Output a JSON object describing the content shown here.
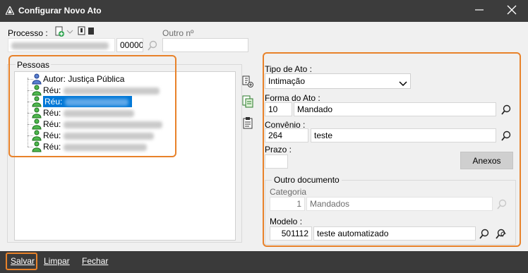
{
  "window": {
    "title": "Configurar Novo Ato",
    "app_icon": "triangle-logo-icon",
    "min_icon": "minimize-icon",
    "close_icon": "close-icon"
  },
  "processo": {
    "label": "Processo :",
    "number_value": "",
    "suffix_value": "00000",
    "outro_label": "Outro nº",
    "outro_value": ""
  },
  "pessoas": {
    "legend": "Pessoas",
    "items": [
      {
        "prefix": "Autor:",
        "name": "Justiça Pública",
        "icon": "person-blue-icon",
        "selected": false
      },
      {
        "prefix": "Réu:",
        "name": "",
        "icon": "person-green-icon",
        "selected": false
      },
      {
        "prefix": "Réu:",
        "name": "",
        "icon": "person-green-icon",
        "selected": true
      },
      {
        "prefix": "Réu:",
        "name": "",
        "icon": "person-green-icon",
        "selected": false
      },
      {
        "prefix": "Réu:",
        "name": "",
        "icon": "person-green-icon",
        "selected": false
      },
      {
        "prefix": "Réu:",
        "name": "",
        "icon": "person-green-icon",
        "selected": false
      },
      {
        "prefix": "Réu:",
        "name": "",
        "icon": "person-green-icon",
        "selected": false
      }
    ]
  },
  "ato": {
    "tipo_label": "Tipo de Ato :",
    "tipo_value": "Intimação",
    "forma_label": "Forma do Ato :",
    "forma_code": "10",
    "forma_value": "Mandado",
    "convenio_label": "Convênio :",
    "convenio_code": "264",
    "convenio_value": "teste",
    "prazo_label": "Prazo :",
    "prazo_value": "",
    "anexos_label": "Anexos"
  },
  "outro_documento": {
    "legend": "Outro documento",
    "categoria_label": "Categoria",
    "categoria_code": "1",
    "categoria_value": "Mandados",
    "modelo_label": "Modelo :",
    "modelo_code": "501112",
    "modelo_value": "teste automatizado"
  },
  "footer": {
    "salvar": "Salvar",
    "limpar": "Limpar",
    "fechar": "Fechar"
  }
}
